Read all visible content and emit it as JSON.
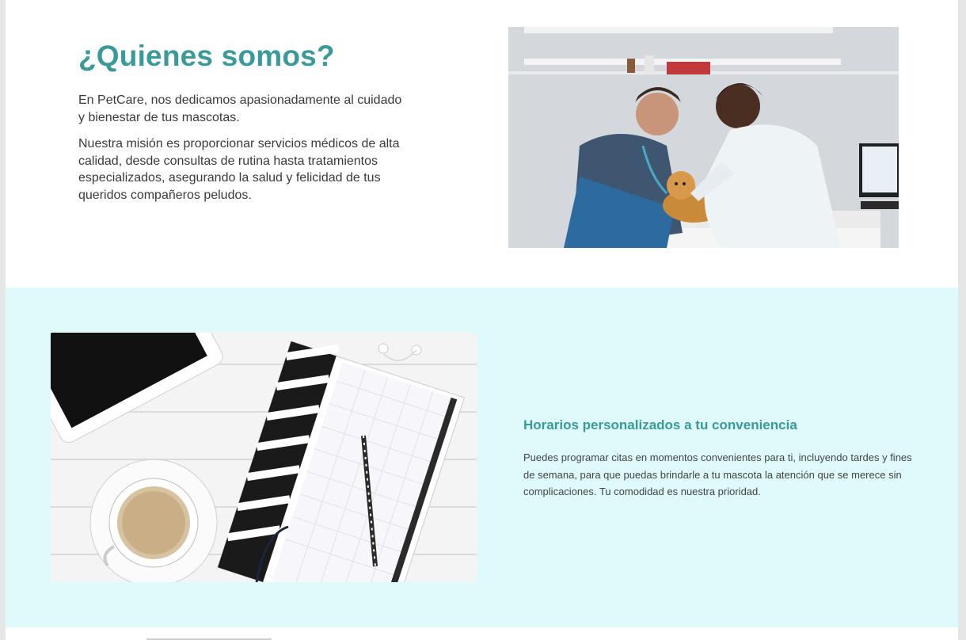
{
  "about": {
    "title": "¿Quienes somos?",
    "paragraph1": "En PetCare, nos dedicamos apasionadamente al cuidado y bienestar de tus mascotas.",
    "paragraph2": "Nuestra misión es proporcionar servicios médicos de alta calidad, desde consultas de rutina hasta tratamientos especializados, asegurando la salud y felicidad de tus queridos compañeros peludos."
  },
  "hours": {
    "title": "Horarios personalizados a tu conveniencia",
    "text": "Puedes programar citas en momentos convenientes para ti, incluyendo tardes y fines de semana, para que puedas brindarle a tu mascota la atención que se merece sin complicaciones. Tu comodidad es nuestra prioridad."
  },
  "colors": {
    "accent": "#3a9a9a",
    "section_background": "#defafb",
    "text": "#3a3a3a"
  }
}
